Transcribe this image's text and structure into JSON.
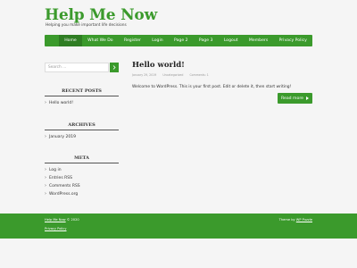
{
  "site": {
    "title": "Help Me Now",
    "tagline": "Helping you make important life decisions"
  },
  "nav": {
    "items": [
      {
        "label": "Home",
        "active": true
      },
      {
        "label": "What We Do"
      },
      {
        "label": "Register"
      },
      {
        "label": "Login"
      },
      {
        "label": "Page 2"
      },
      {
        "label": "Page 3"
      },
      {
        "label": "Logout"
      },
      {
        "label": "Members"
      },
      {
        "label": "Privacy Policy"
      }
    ]
  },
  "search": {
    "placeholder": "Search ..."
  },
  "sidebar": {
    "recent_posts": {
      "title": "RECENT POSTS",
      "items": [
        "Hello world!"
      ]
    },
    "archives": {
      "title": "ARCHIVES",
      "items": [
        "January 2019"
      ]
    },
    "meta": {
      "title": "META",
      "items": [
        "Log in",
        "Entries RSS",
        "Comments RSS",
        "WordPress.org"
      ]
    }
  },
  "post": {
    "title": "Hello world!",
    "date": "January 29, 2019",
    "category": "Uncategorized",
    "comments": "Comments: 1",
    "body": "Welcome to WordPress. This is your first post. Edit or delete it, then start writing!",
    "read_more": "Read more"
  },
  "footer": {
    "site_link": "Help Me Now",
    "copyright": "© 2020",
    "privacy_link": "Privacy Policy",
    "theme_prefix": "Theme by",
    "theme_link": "WP Puzzle"
  },
  "colors": {
    "accent": "#3b9a2c",
    "accent_dark": "#2f7d23",
    "background": "#f5f5f5"
  }
}
